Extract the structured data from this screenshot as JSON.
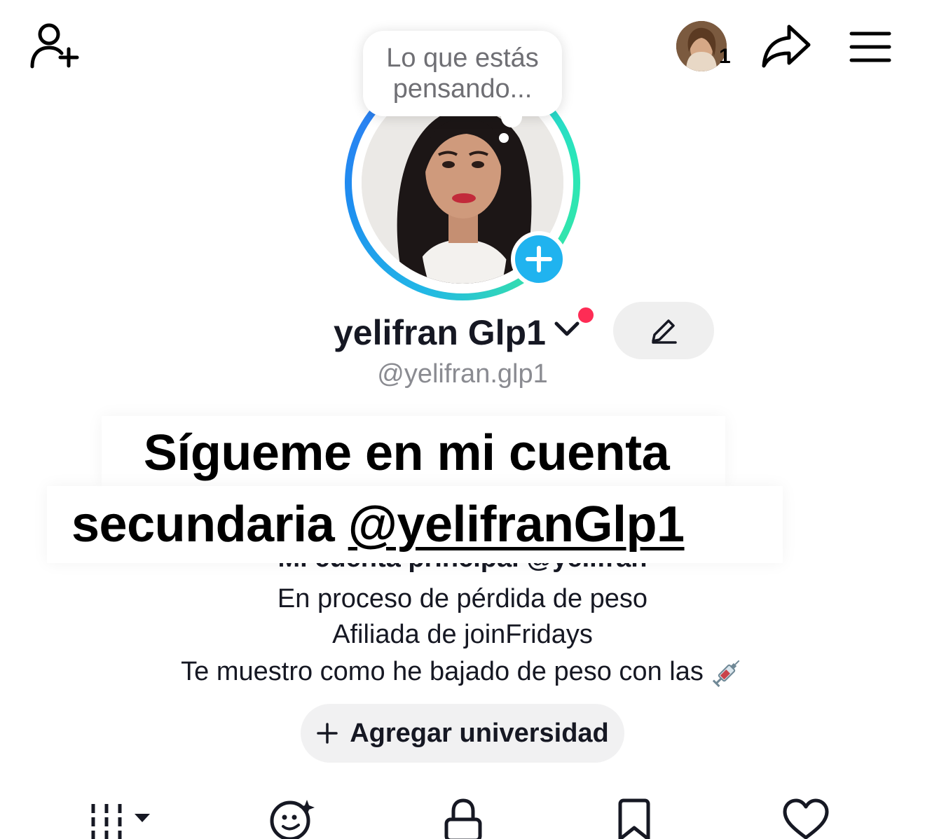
{
  "header": {
    "add_friend_icon": "person-plus-icon",
    "account_count": "1",
    "share_icon": "share-arrow-icon",
    "menu_icon": "hamburger-menu-icon"
  },
  "thought_bubble": {
    "text": "Lo que estás pensando..."
  },
  "profile": {
    "display_name": "yelifran Glp1",
    "handle": "@yelifran.glp1",
    "ring_colors": [
      "#1e8df0",
      "#2be7b6"
    ],
    "badge_color": "#20b3ef",
    "notification_dot_color": "#fe2c55"
  },
  "overlay": {
    "line1": "Sígueme en mi cuenta",
    "line2_prefix": "secundaria ",
    "line2_handle": "@yelifranGlp1"
  },
  "bio": {
    "partially_hidden": "Mi cuenta principal @yelifran",
    "line1": "En proceso de pérdida de peso",
    "line2": "Afiliada de joinFridays",
    "line3": "Te muestro como he bajado de peso con las"
  },
  "add_university": {
    "label": "Agregar universidad"
  },
  "tabs": [
    {
      "icon": "grid-videos-icon"
    },
    {
      "icon": "ai-face-icon"
    },
    {
      "icon": "lock-icon"
    },
    {
      "icon": "bookmark-icon"
    },
    {
      "icon": "heart-icon"
    }
  ]
}
